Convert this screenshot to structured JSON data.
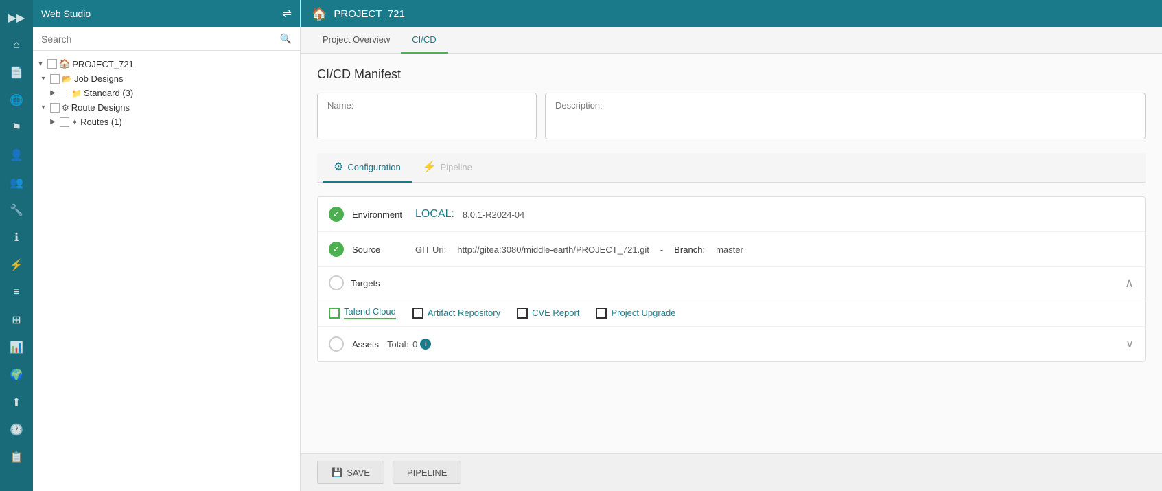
{
  "app": {
    "title": "Web Studio",
    "project_name": "PROJECT_721"
  },
  "sidebar": {
    "search_placeholder": "Search",
    "tree": [
      {
        "level": 0,
        "toggle": "▾",
        "has_checkbox": true,
        "icon": "🏠",
        "label": "PROJECT_721",
        "indent": 0
      },
      {
        "level": 1,
        "toggle": "▾",
        "has_checkbox": true,
        "icon": "📂",
        "label": "Job Designs",
        "indent": 1
      },
      {
        "level": 2,
        "toggle": "▶",
        "has_checkbox": true,
        "icon": "📁",
        "label": "Standard (3)",
        "indent": 2
      },
      {
        "level": 1,
        "toggle": "▾",
        "has_checkbox": true,
        "icon": "⚙",
        "label": "Route Designs",
        "indent": 1
      },
      {
        "level": 2,
        "toggle": "▶",
        "has_checkbox": true,
        "icon": "✦",
        "label": "Routes (1)",
        "indent": 2
      }
    ]
  },
  "tabs": {
    "project_overview": "Project Overview",
    "cicd": "CI/CD"
  },
  "content": {
    "manifest_title": "CI/CD Manifest",
    "name_label": "Name:",
    "name_value": "",
    "description_label": "Description:",
    "description_value": "",
    "sub_tabs": [
      {
        "id": "configuration",
        "label": "Configuration",
        "icon": "⚙",
        "active": true
      },
      {
        "id": "pipeline",
        "label": "Pipeline",
        "icon": "⚡",
        "active": false
      }
    ],
    "environment": {
      "label": "Environment",
      "env_name": "LOCAL:",
      "env_version": "8.0.1-R2024-04",
      "status": "ok"
    },
    "source": {
      "label": "Source",
      "git_uri_label": "GIT Uri:",
      "git_uri": "http://gitea:3080/middle-earth/PROJECT_721.git",
      "branch_label": "Branch:",
      "branch": "master",
      "status": "ok"
    },
    "targets": {
      "label": "Targets",
      "items": [
        {
          "id": "talend-cloud",
          "label": "Talend Cloud",
          "selected": true
        },
        {
          "id": "artifact-repository",
          "label": "Artifact Repository",
          "selected": false
        },
        {
          "id": "cve-report",
          "label": "CVE Report",
          "selected": false
        },
        {
          "id": "project-upgrade",
          "label": "Project Upgrade",
          "selected": false
        }
      ]
    },
    "assets": {
      "label": "Assets",
      "total_label": "Total:",
      "total_value": "0"
    }
  },
  "footer": {
    "save_label": "SAVE",
    "pipeline_label": "PIPELINE",
    "save_icon": "💾"
  },
  "icons": {
    "home": "⌂",
    "docs": "📄",
    "globe": "🌐",
    "person": "👤",
    "group": "👥",
    "tools": "🔧",
    "info": "ℹ",
    "lightning": "⚡",
    "list": "≡",
    "grid": "⊞",
    "chart": "📊",
    "upload": "⬆",
    "clock": "🕐",
    "clipboard": "📋",
    "search": "🔍",
    "chevron_down": "❯",
    "expand": "❯",
    "arrows": "⇌"
  }
}
